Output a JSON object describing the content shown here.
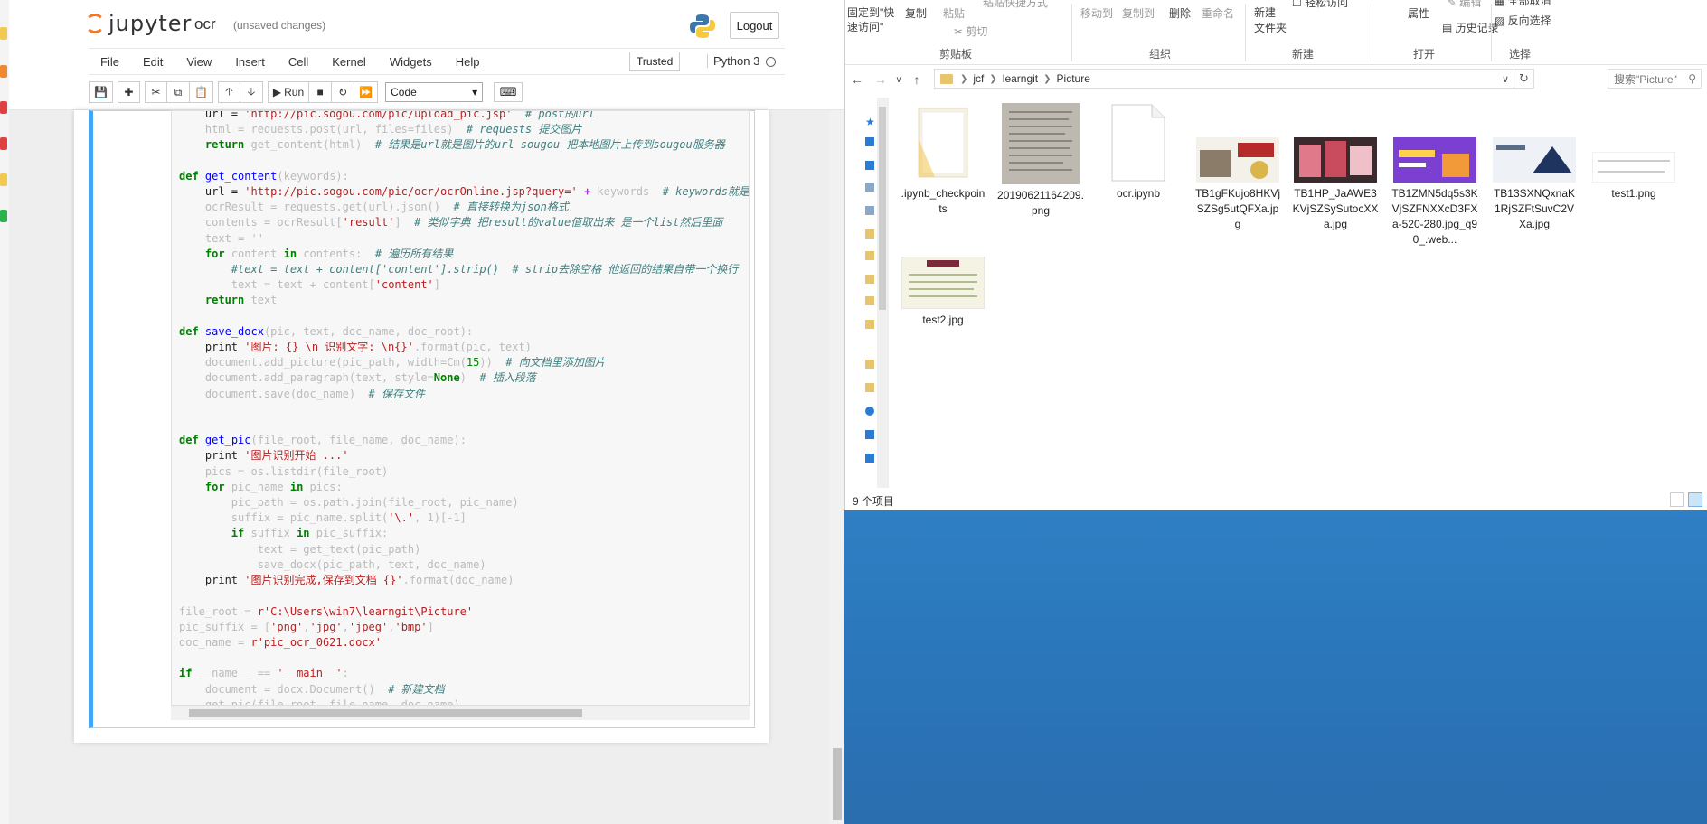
{
  "jupyter": {
    "logo_text": "jupyter",
    "notebook_name": "ocr",
    "save_status": "(unsaved changes)",
    "logout_label": "Logout",
    "menu": [
      "File",
      "Edit",
      "View",
      "Insert",
      "Cell",
      "Kernel",
      "Widgets",
      "Help"
    ],
    "trusted_label": "Trusted",
    "kernel_name": "Python 3",
    "toolbar": {
      "run_label": "Run",
      "cell_type": "Code"
    }
  },
  "explorer": {
    "ribbon": {
      "pin_quick_access": "固定到\"快速访问\"",
      "copy": "复制",
      "paste": "粘贴",
      "paste_shortcut": "粘贴快捷方式",
      "cut": "剪切",
      "move_to": "移动到",
      "copy_to": "复制到",
      "delete": "删除",
      "rename": "重命名",
      "new_folder": "新建\n文件夹",
      "easy_access": "轻松访问",
      "properties": "属性",
      "edit": "编辑",
      "history": "历史记录",
      "select_all": "全部选择",
      "select_none": "全部取消",
      "invert_selection": "反向选择",
      "groups": {
        "clipboard": "剪贴板",
        "organize": "组织",
        "new": "新建",
        "open": "打开",
        "select": "选择"
      }
    },
    "address": {
      "crumbs": [
        "jcf",
        "learngit",
        "Picture"
      ],
      "search_placeholder": "搜索\"Picture\""
    },
    "files": [
      {
        "name": ".ipynb_checkpoints",
        "kind": "folder"
      },
      {
        "name": "20190621164209.png",
        "kind": "image-doc"
      },
      {
        "name": "ocr.ipynb",
        "kind": "blank"
      },
      {
        "name": "TB1gFKujo8HKVjSZSg5utQFXa.jpg",
        "kind": "image"
      },
      {
        "name": "TB1HP_JaAWE3KVjSZSySutocXXa.jpg",
        "kind": "image"
      },
      {
        "name": "TB1ZMN5dq5s3KVjSZFNXXcD3FXa-520-280.jpg_q90_.web...",
        "kind": "image"
      },
      {
        "name": "TB13SXNQxnaK1RjSZFtSuvC2VXa.jpg",
        "kind": "image"
      },
      {
        "name": "test1.png",
        "kind": "image-text"
      },
      {
        "name": "test2.jpg",
        "kind": "image-text"
      }
    ],
    "status_text": "9 个项目"
  }
}
